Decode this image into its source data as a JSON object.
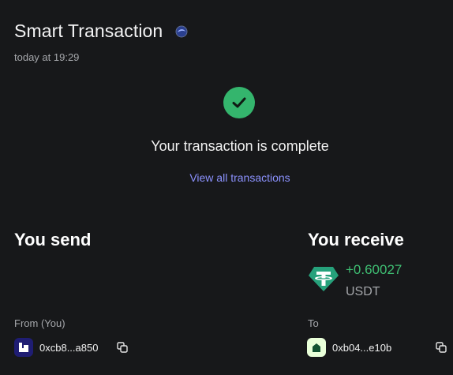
{
  "header": {
    "title": "Smart Transaction",
    "timestamp": "today at 19:29"
  },
  "status": {
    "message": "Your transaction is complete",
    "link_label": "View all transactions",
    "color": "#34b56d"
  },
  "send": {
    "heading": "You send",
    "from_label": "From (You)",
    "address": "0xcb8...a850"
  },
  "receive": {
    "heading": "You receive",
    "amount": "+0.60027",
    "symbol": "USDT",
    "to_label": "To",
    "address": "0xb04...e10b",
    "token_color": "#26a17b"
  },
  "icons": [
    "smart-transaction-icon",
    "check-icon",
    "usdt-token-icon",
    "copy-icon"
  ],
  "colors": {
    "background": "#17181a",
    "link": "#8c92ff",
    "amount_positive": "#3fbf73"
  }
}
